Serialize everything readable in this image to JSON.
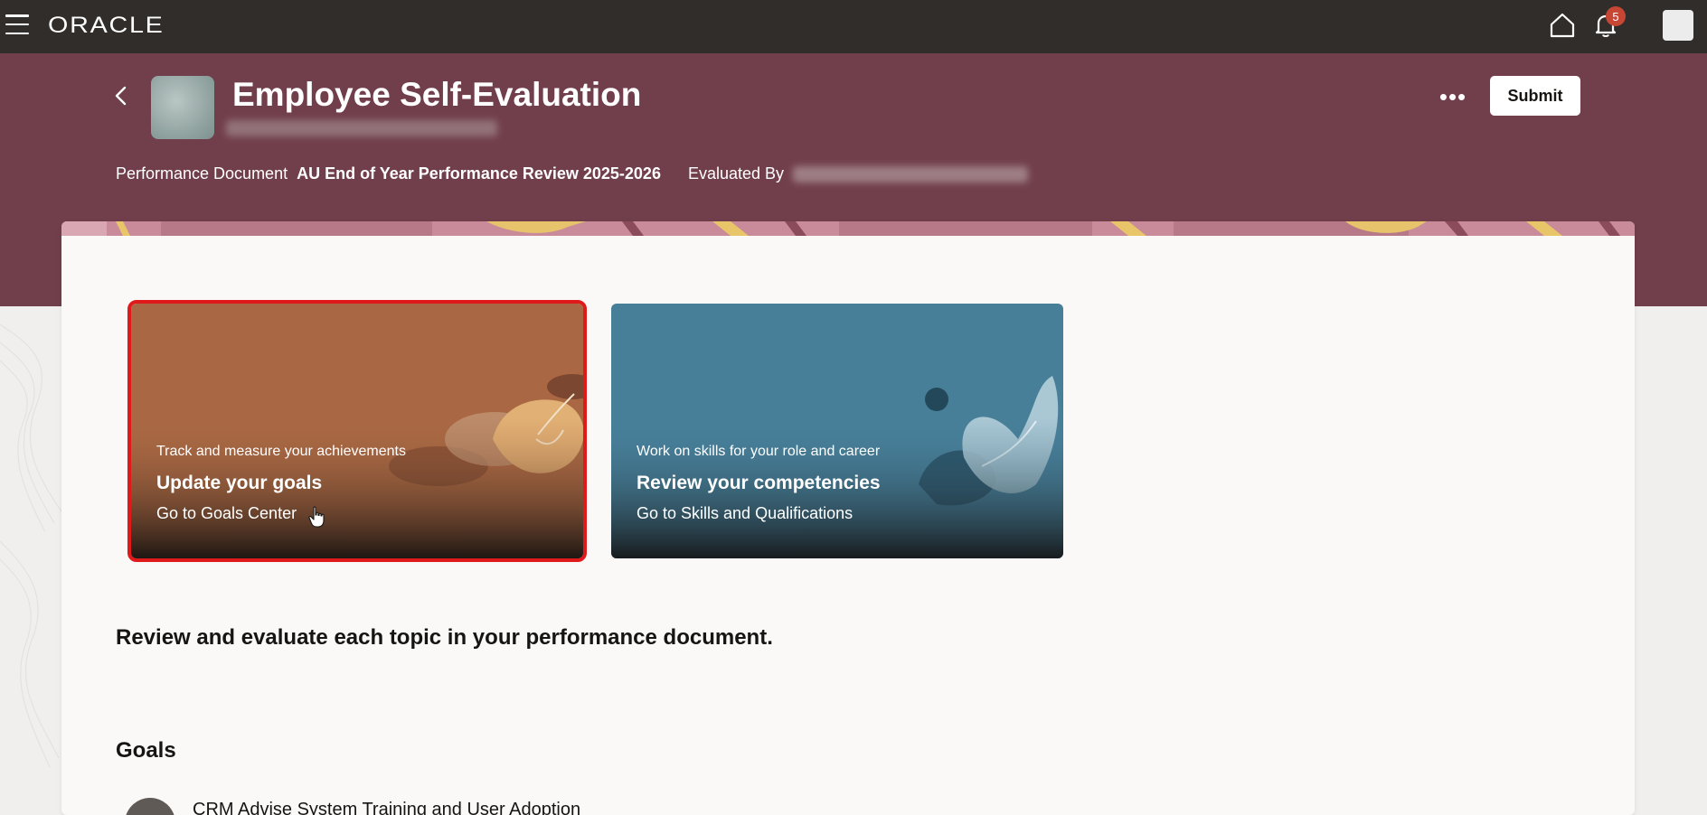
{
  "topbar": {
    "logo_text": "ORACLE",
    "notification_count": "5",
    "icons": [
      "hamburger-menu-icon",
      "home-icon",
      "bell-icon",
      "user-avatar"
    ]
  },
  "header": {
    "title": "Employee Self-Evaluation",
    "more_label": "•••",
    "submit_label": "Submit",
    "performance_document_label": "Performance Document",
    "performance_document_value": "AU End of Year Performance Review 2025-2026",
    "evaluated_by_label": "Evaluated By",
    "background_color": "#713f4b"
  },
  "tiles": [
    {
      "eyebrow": "Track and measure your achievements",
      "title": "Update your goals",
      "link": "Go to Goals Center",
      "color": "#a96843",
      "selected": true
    },
    {
      "eyebrow": "Work on skills for your role and career",
      "title": "Review your competencies",
      "link": "Go to Skills and Qualifications",
      "color": "#477f99",
      "selected": false
    }
  ],
  "main": {
    "intro": "Review and evaluate each topic in your performance document.",
    "section_heading": "Goals",
    "goals": [
      {
        "name": "CRM Advise System Training and User Adoption"
      }
    ]
  },
  "colors": {
    "topbar": "#312d2a",
    "accent_red": "#c74634",
    "selection_outline": "#e0191b"
  }
}
